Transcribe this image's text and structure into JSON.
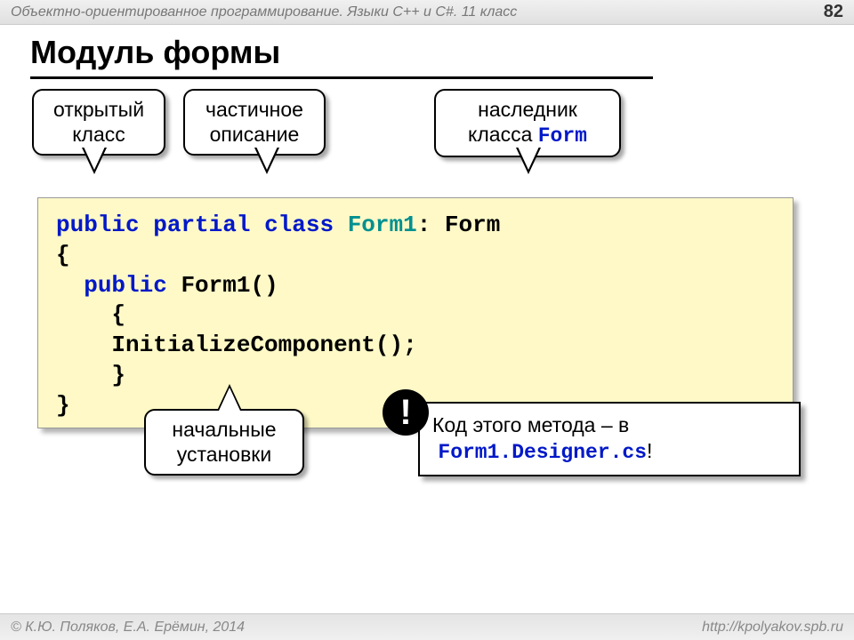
{
  "header": {
    "course": "Объектно-ориентированное программирование. Языки C++ и C#. 11 класс",
    "page": "82"
  },
  "title": "Модуль формы",
  "callouts": {
    "c1": {
      "line1": "открытый",
      "line2": "класс"
    },
    "c2": {
      "line1": "частичное",
      "line2": "описание"
    },
    "c3": {
      "line1": "наследник",
      "line2_a": "класса ",
      "line2_b": "Form"
    },
    "c4": {
      "line1": "начальные",
      "line2": "установки"
    }
  },
  "code": {
    "kw_public": "public",
    "kw_partial": "partial",
    "kw_class": "class",
    "cls_form1": "Form1",
    "colon_form": ": Form",
    "brace_open": "{",
    "ctor": "Form1()",
    "init": "InitializeComponent();",
    "brace_close": "}"
  },
  "note": {
    "bang": "!",
    "text1": "Код этого метода – в",
    "file": "Form1.Designer.cs",
    "excl": "!"
  },
  "footer": {
    "left": "© К.Ю. Поляков, Е.А. Ерёмин, 2014",
    "right": "http://kpolyakov.spb.ru"
  }
}
